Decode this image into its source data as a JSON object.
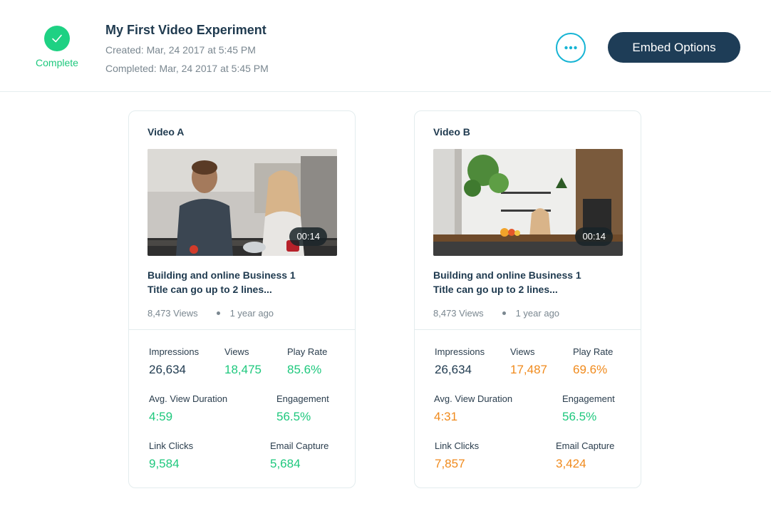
{
  "header": {
    "status_label": "Complete",
    "title": "My First Video Experiment",
    "created": "Created: Mar, 24 2017 at 5:45 PM",
    "completed": "Completed: Mar, 24 2017 at 5:45 PM",
    "more_icon": "ellipsis-icon",
    "embed_label": "Embed Options"
  },
  "colors": {
    "success": "#1ed183",
    "accent": "#16b4d4",
    "primary": "#1e3d57",
    "winner": "#1ec87d",
    "loser": "#f08a1c"
  },
  "videos": [
    {
      "label": "Video A",
      "duration": "00:14",
      "title_line1": "Building and online Business 1",
      "title_line2": "Title can go up to 2 lines...",
      "views_text": "8,473 Views",
      "age": "1 year ago",
      "stats": {
        "impressions_label": "Impressions",
        "impressions": "26,634",
        "views_label": "Views",
        "views": "18,475",
        "play_rate_label": "Play Rate",
        "play_rate": "85.6%",
        "avg_label": "Avg. View Duration",
        "avg": "4:59",
        "engagement_label": "Engagement",
        "engagement": "56.5%",
        "clicks_label": "Link Clicks",
        "clicks": "9,584",
        "email_label": "Email Capture",
        "email": "5,684"
      }
    },
    {
      "label": "Video B",
      "duration": "00:14",
      "title_line1": "Building and online Business 1",
      "title_line2": "Title can go up to 2 lines...",
      "views_text": "8,473 Views",
      "age": "1 year ago",
      "stats": {
        "impressions_label": "Impressions",
        "impressions": "26,634",
        "views_label": "Views",
        "views": "17,487",
        "play_rate_label": "Play Rate",
        "play_rate": "69.6%",
        "avg_label": "Avg. View Duration",
        "avg": "4:31",
        "engagement_label": "Engagement",
        "engagement": "56.5%",
        "clicks_label": "Link Clicks",
        "clicks": "7,857",
        "email_label": "Email Capture",
        "email": "3,424"
      }
    }
  ]
}
